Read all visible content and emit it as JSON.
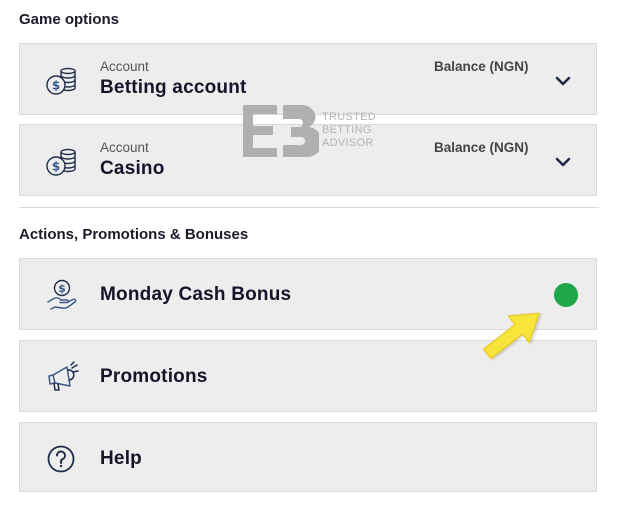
{
  "sections": {
    "game_options": "Game options",
    "actions": "Actions, Promotions & Bonuses"
  },
  "accounts": [
    {
      "small_label": "Account",
      "name": "Betting account",
      "balance_label": "Balance (NGN)",
      "icon": "coins-dollar-icon"
    },
    {
      "small_label": "Account",
      "name": "Casino",
      "balance_label": "Balance (NGN)",
      "icon": "coins-dollar-icon"
    }
  ],
  "menu": [
    {
      "label": "Monday Cash Bonus",
      "icon": "hand-dollar-icon",
      "status": "active"
    },
    {
      "label": "Promotions",
      "icon": "megaphone-icon"
    },
    {
      "label": "Help",
      "icon": "question-circle-icon"
    }
  ],
  "watermark": {
    "lines": [
      "TRUSTED",
      "BETTING",
      "ADVISOR"
    ]
  },
  "colors": {
    "status_green": "#1fa749",
    "arrow_yellow": "#f7e53c",
    "icon_blue": "#3a5a8c",
    "card_bg": "#ededed"
  }
}
